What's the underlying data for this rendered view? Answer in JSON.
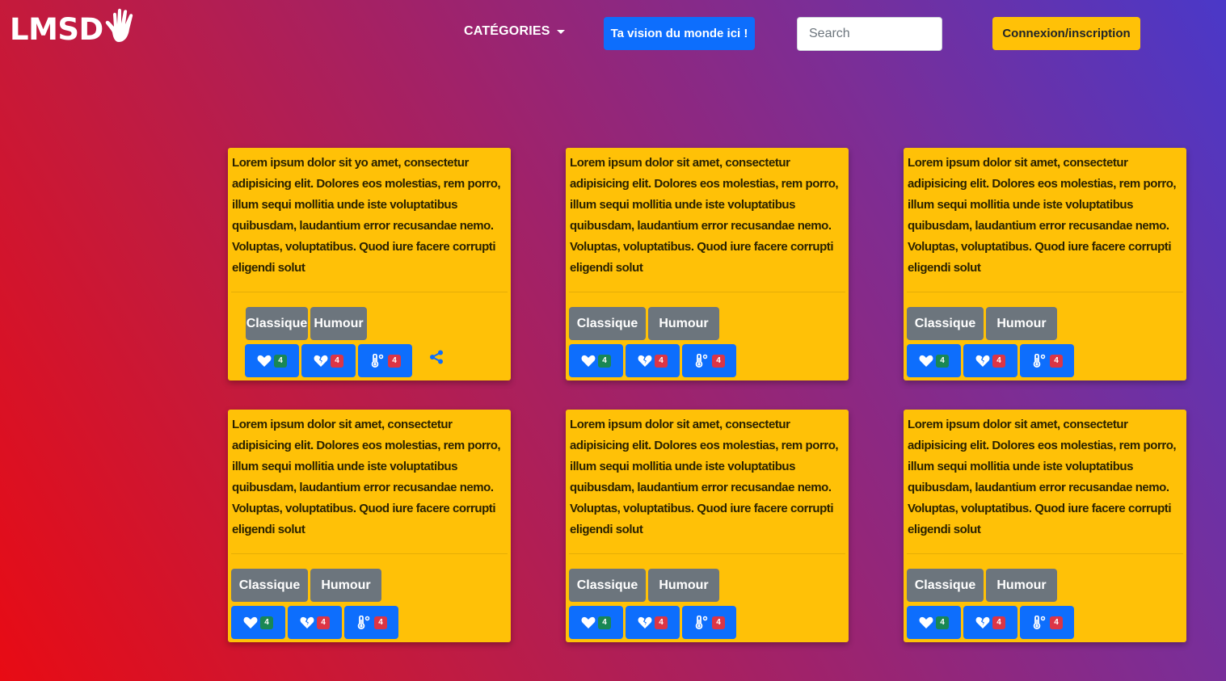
{
  "header": {
    "logo_text": "LMSD",
    "categories_label": "CATÉGORIES",
    "vision_button": "Ta vision du monde ici !",
    "search_placeholder": "Search",
    "login_button": "Connexion/inscription"
  },
  "colors": {
    "card": "#ffc107",
    "primary": "#0d6efd",
    "secondary": "#6c757d",
    "success": "#198754",
    "danger": "#dc3545"
  },
  "icons": [
    "hand-icon",
    "heart-icon",
    "broken-heart-icon",
    "thermometer-icon",
    "share-icon"
  ],
  "cards": [
    {
      "text": "Lorem ipsum dolor sit yo amet, consectetur adipisicing elit. Dolores eos molestias, rem porro, illum sequi mollitia unde iste voluptatibus quibusdam, laudantium error recusandae nemo. Voluptas, voluptatibus. Quod iure facere corrupti eligendi solut",
      "tags": [
        "Classique",
        "Humour"
      ],
      "likes": "4",
      "dislikes": "4",
      "temperature": "4"
    },
    {
      "text": "Lorem ipsum dolor sit amet, consectetur adipisicing elit. Dolores eos molestias, rem porro, illum sequi mollitia unde iste voluptatibus quibusdam, laudantium error recusandae nemo. Voluptas, voluptatibus. Quod iure facere corrupti eligendi solut",
      "tags": [
        "Classique",
        "Humour"
      ],
      "likes": "4",
      "dislikes": "4",
      "temperature": "4"
    },
    {
      "text": "Lorem ipsum dolor sit amet, consectetur adipisicing elit. Dolores eos molestias, rem porro, illum sequi mollitia unde iste voluptatibus quibusdam, laudantium error recusandae nemo. Voluptas, voluptatibus. Quod iure facere corrupti eligendi solut",
      "tags": [
        "Classique",
        "Humour"
      ],
      "likes": "4",
      "dislikes": "4",
      "temperature": "4"
    },
    {
      "text": "Lorem ipsum dolor sit amet, consectetur adipisicing elit. Dolores eos molestias, rem porro, illum sequi mollitia unde iste voluptatibus quibusdam, laudantium error recusandae nemo. Voluptas, voluptatibus. Quod iure facere corrupti eligendi solut",
      "tags": [
        "Classique",
        "Humour"
      ],
      "likes": "4",
      "dislikes": "4",
      "temperature": "4"
    },
    {
      "text": "Lorem ipsum dolor sit amet, consectetur adipisicing elit. Dolores eos molestias, rem porro, illum sequi mollitia unde iste voluptatibus quibusdam, laudantium error recusandae nemo. Voluptas, voluptatibus. Quod iure facere corrupti eligendi solut",
      "tags": [
        "Classique",
        "Humour"
      ],
      "likes": "4",
      "dislikes": "4",
      "temperature": "4"
    },
    {
      "text": "Lorem ipsum dolor sit amet, consectetur adipisicing elit. Dolores eos molestias, rem porro, illum sequi mollitia unde iste voluptatibus quibusdam, laudantium error recusandae nemo. Voluptas, voluptatibus. Quod iure facere corrupti eligendi solut",
      "tags": [
        "Classique",
        "Humour"
      ],
      "likes": "4",
      "dislikes": "4",
      "temperature": "4"
    }
  ]
}
